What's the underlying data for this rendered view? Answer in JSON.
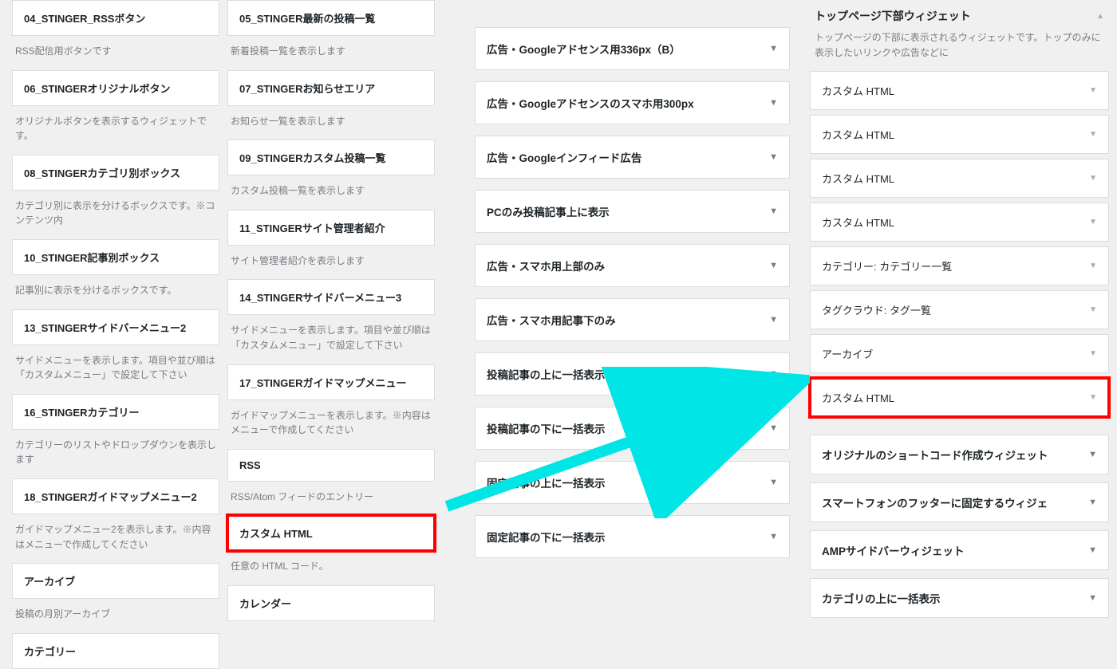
{
  "available_left": [
    {
      "title": "04_STINGER_RSSボタン",
      "desc": "RSS配信用ボタンです"
    },
    {
      "title": "06_STINGERオリジナルボタン",
      "desc": "オリジナルボタンを表示するウィジェットです。"
    },
    {
      "title": "08_STINGERカテゴリ別ボックス",
      "desc": "カテゴリ別に表示を分けるボックスです。※コンテンツ内"
    },
    {
      "title": "10_STINGER記事別ボックス",
      "desc": "記事別に表示を分けるボックスです。"
    },
    {
      "title": "13_STINGERサイドバーメニュー2",
      "desc": "サイドメニューを表示します。項目や並び順は「カスタムメニュー」で設定して下さい"
    },
    {
      "title": "16_STINGERカテゴリー",
      "desc": "カテゴリーのリストやドロップダウンを表示します"
    },
    {
      "title": "18_STINGERガイドマップメニュー2",
      "desc": "ガイドマップメニュー2を表示します。※内容はメニューで作成してください"
    },
    {
      "title": "アーカイブ",
      "desc": "投稿の月別アーカイブ"
    },
    {
      "title": "カテゴリー",
      "desc": ""
    }
  ],
  "available_right": [
    {
      "title": "05_STINGER最新の投稿一覧",
      "desc": "新着投稿一覧を表示します"
    },
    {
      "title": "07_STINGERお知らせエリア",
      "desc": "お知らせ一覧を表示します"
    },
    {
      "title": "09_STINGERカスタム投稿一覧",
      "desc": "カスタム投稿一覧を表示します"
    },
    {
      "title": "11_STINGERサイト管理者紹介",
      "desc": "サイト管理者紹介を表示します"
    },
    {
      "title": "14_STINGERサイドバーメニュー3",
      "desc": "サイドメニューを表示します。項目や並び順は「カスタムメニュー」で設定して下さい"
    },
    {
      "title": "17_STINGERガイドマップメニュー",
      "desc": "ガイドマップメニューを表示します。※内容はメニューで作成してください"
    },
    {
      "title": "RSS",
      "desc": "RSS/Atom フィードのエントリー"
    },
    {
      "title": "カスタム HTML",
      "desc": "任意の HTML コード。",
      "highlight": true
    },
    {
      "title": "カレンダー",
      "desc": ""
    }
  ],
  "mid_areas": [
    "広告・Googleアドセンス用336px（B）",
    "広告・Googleアドセンスのスマホ用300px",
    "広告・Googleインフィード広告",
    "PCのみ投稿記事上に表示",
    "広告・スマホ用上部のみ",
    "広告・スマホ用記事下のみ",
    "投稿記事の上に一括表示",
    "投稿記事の下に一括表示",
    "固定記事の上に一括表示",
    "固定記事の下に一括表示"
  ],
  "right_area": {
    "title": "トップページ下部ウィジェット",
    "desc": "トップページの下部に表示されるウィジェットです。トップのみに表示したいリンクや広告などに",
    "placed": [
      {
        "label": "カスタム HTML"
      },
      {
        "label": "カスタム HTML"
      },
      {
        "label": "カスタム HTML"
      },
      {
        "label": "カスタム HTML"
      },
      {
        "label": "カテゴリー: カテゴリー一覧"
      },
      {
        "label": "タグクラウド: タグ一覧"
      },
      {
        "label": "アーカイブ"
      },
      {
        "label": "カスタム HTML",
        "highlight": true
      }
    ],
    "other_areas": [
      "オリジナルのショートコード作成ウィジェット",
      "スマートフォンのフッターに固定するウィジェ",
      "AMPサイドバーウィジェット",
      "カテゴリの上に一括表示"
    ]
  },
  "icons": {
    "caret": "▼",
    "caret_up": "▲"
  }
}
